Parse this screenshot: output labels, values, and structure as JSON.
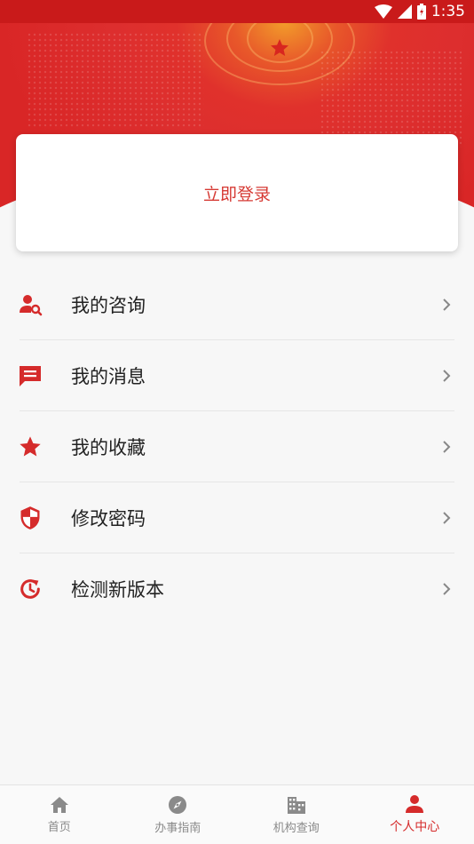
{
  "status_bar": {
    "time": "1:35"
  },
  "login": {
    "label": "立即登录"
  },
  "menu": {
    "items": [
      {
        "label": "我的咨询",
        "icon": "user-search-icon"
      },
      {
        "label": "我的消息",
        "icon": "message-icon"
      },
      {
        "label": "我的收藏",
        "icon": "star-icon"
      },
      {
        "label": "修改密码",
        "icon": "shield-icon"
      },
      {
        "label": "检测新版本",
        "icon": "update-clock-icon"
      }
    ]
  },
  "tabs": [
    {
      "label": "首页",
      "icon": "home-icon",
      "active": false
    },
    {
      "label": "办事指南",
      "icon": "compass-icon",
      "active": false
    },
    {
      "label": "机构查询",
      "icon": "building-icon",
      "active": false
    },
    {
      "label": "个人中心",
      "icon": "person-icon",
      "active": true
    }
  ],
  "colors": {
    "accent": "#d52b2b",
    "header": "#dd2e2e"
  }
}
